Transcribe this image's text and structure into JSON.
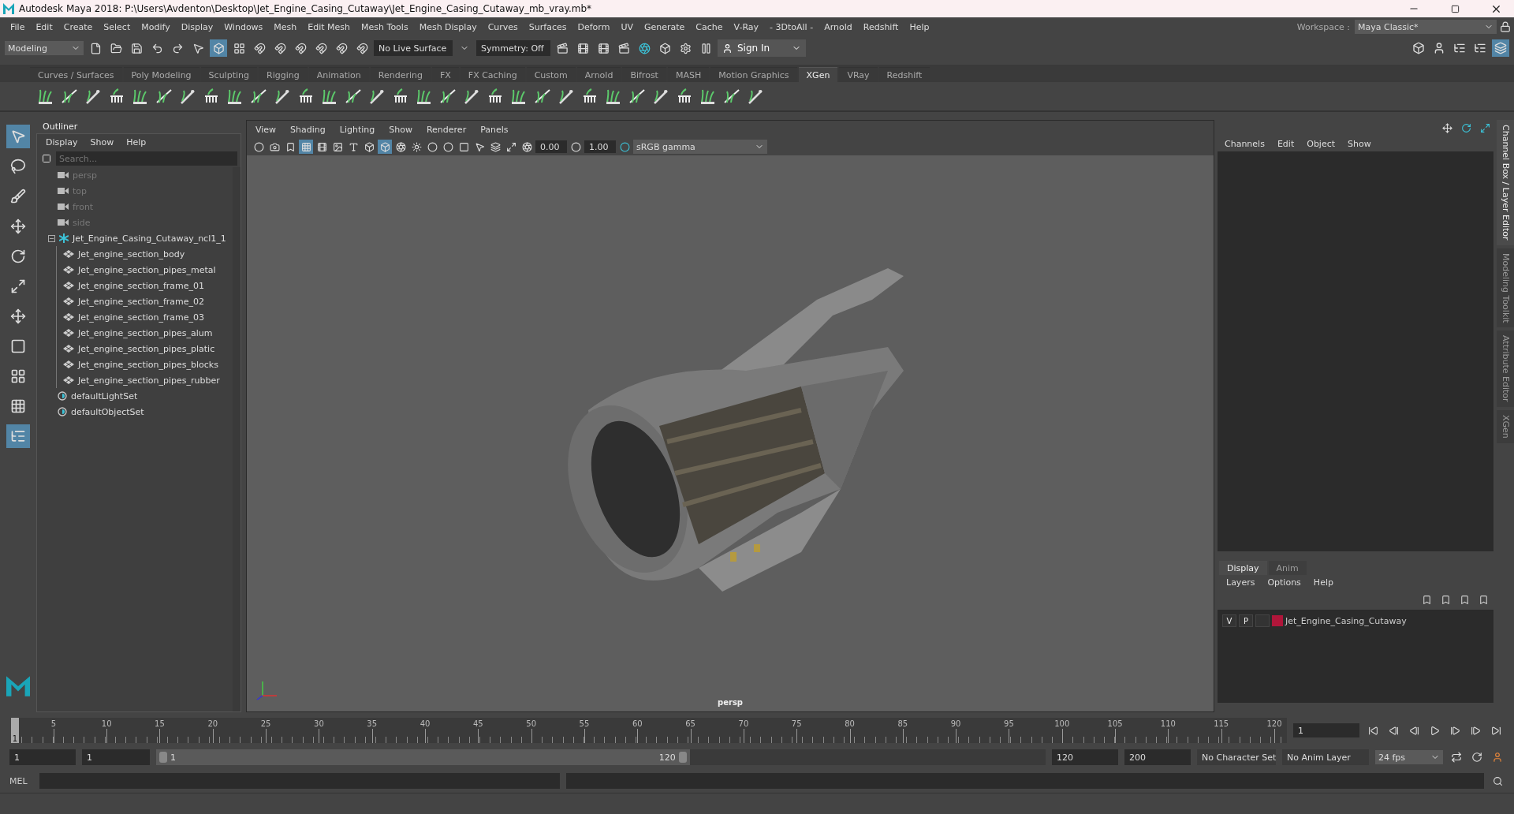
{
  "window": {
    "title": "Autodesk Maya 2018: P:\\Users\\Avdenton\\Desktop\\Jet_Engine_Casing_Cutaway\\Jet_Engine_Casing_Cutaway_mb_vray.mb*"
  },
  "menu_bar": [
    "File",
    "Edit",
    "Create",
    "Select",
    "Modify",
    "Display",
    "Windows",
    "Mesh",
    "Edit Mesh",
    "Mesh Tools",
    "Mesh Display",
    "Curves",
    "Surfaces",
    "Deform",
    "UV",
    "Generate",
    "Cache",
    "V-Ray",
    "- 3DtoAll -",
    "Arnold",
    "Redshift",
    "Help"
  ],
  "workspace": {
    "label": "Workspace :",
    "value": "Maya Classic*"
  },
  "status_line": {
    "mode": "Modeling",
    "live_surface": "No Live Surface",
    "symmetry": "Symmetry: Off",
    "sign_in": "Sign In"
  },
  "shelf_tabs": [
    {
      "label": "Curves / Surfaces",
      "selected": false
    },
    {
      "label": "Poly Modeling",
      "selected": false
    },
    {
      "label": "Sculpting",
      "selected": false
    },
    {
      "label": "Rigging",
      "selected": false
    },
    {
      "label": "Animation",
      "selected": false
    },
    {
      "label": "Rendering",
      "selected": false
    },
    {
      "label": "FX",
      "selected": false
    },
    {
      "label": "FX Caching",
      "selected": false
    },
    {
      "label": "Custom",
      "selected": false
    },
    {
      "label": "Arnold",
      "selected": false
    },
    {
      "label": "Bifrost",
      "selected": false
    },
    {
      "label": "MASH",
      "selected": false
    },
    {
      "label": "Motion Graphics",
      "selected": false
    },
    {
      "label": "XGen",
      "selected": true
    },
    {
      "label": "VRay",
      "selected": false
    },
    {
      "label": "Redshift",
      "selected": false
    }
  ],
  "outliner": {
    "title": "Outliner",
    "menu": [
      "Display",
      "Show",
      "Help"
    ],
    "search_placeholder": "Search...",
    "items": [
      {
        "label": "persp",
        "kind": "camera",
        "disabled": true
      },
      {
        "label": "top",
        "kind": "camera",
        "disabled": true
      },
      {
        "label": "front",
        "kind": "camera",
        "disabled": true
      },
      {
        "label": "side",
        "kind": "camera",
        "disabled": true
      },
      {
        "label": "Jet_Engine_Casing_Cutaway_ncl1_1",
        "kind": "group",
        "disabled": false,
        "expanded": true,
        "children": [
          {
            "label": "Jet_engine_section_body",
            "kind": "mesh",
            "disabled": false
          },
          {
            "label": "Jet_engine_section_pipes_metal",
            "kind": "mesh",
            "disabled": false
          },
          {
            "label": "Jet_engine_section_frame_01",
            "kind": "mesh",
            "disabled": false
          },
          {
            "label": "Jet_engine_section_frame_02",
            "kind": "mesh",
            "disabled": false
          },
          {
            "label": "Jet_engine_section_frame_03",
            "kind": "mesh",
            "disabled": false
          },
          {
            "label": "Jet_engine_section_pipes_alum",
            "kind": "mesh",
            "disabled": false
          },
          {
            "label": "Jet_engine_section_pipes_platic",
            "kind": "mesh",
            "disabled": false
          },
          {
            "label": "Jet_engine_section_pipes_blocks",
            "kind": "mesh",
            "disabled": false
          },
          {
            "label": "Jet_engine_section_pipes_rubber",
            "kind": "mesh",
            "disabled": false
          }
        ]
      },
      {
        "label": "defaultLightSet",
        "kind": "set",
        "disabled": false
      },
      {
        "label": "defaultObjectSet",
        "kind": "set",
        "disabled": false
      }
    ]
  },
  "viewport": {
    "menu": [
      "View",
      "Shading",
      "Lighting",
      "Show",
      "Renderer",
      "Panels"
    ],
    "exposure": "0.00",
    "gamma": "1.00",
    "color_space": "sRGB gamma",
    "camera_label": "persp"
  },
  "channel_box": {
    "menu": [
      "Channels",
      "Edit",
      "Object",
      "Show"
    ]
  },
  "side_tabs": [
    {
      "label": "Channel Box / Layer Editor",
      "selected": true
    },
    {
      "label": "Modeling Toolkit",
      "selected": false
    },
    {
      "label": "Attribute Editor",
      "selected": false
    },
    {
      "label": "XGen",
      "selected": false
    }
  ],
  "layer_editor": {
    "tabs": [
      {
        "label": "Display",
        "selected": true
      },
      {
        "label": "Anim",
        "selected": false
      }
    ],
    "menu": [
      "Layers",
      "Options",
      "Help"
    ],
    "layers": [
      {
        "visible": "V",
        "playback": "P",
        "name": "Jet_Engine_Casing_Cutaway",
        "color": "#b0163a"
      }
    ]
  },
  "timeline": {
    "current": "1",
    "level": 0,
    "ticks": [
      "5",
      "10",
      "15",
      "20",
      "25",
      "30",
      "35",
      "40",
      "45",
      "50",
      "55",
      "60",
      "65",
      "70",
      "75",
      "80",
      "85",
      "90",
      "95",
      "100",
      "105",
      "110",
      "115",
      "120"
    ],
    "frame_field": "1"
  },
  "range": {
    "level": 0.6,
    "start": "1",
    "playback_start": "1",
    "slider_start": "1",
    "slider_end": "120",
    "playback_end": "120",
    "end": "200",
    "character_set": "No Character Set",
    "anim_layer": "No Anim Layer",
    "fps": "24 fps"
  },
  "command_line": {
    "label": "MEL"
  }
}
